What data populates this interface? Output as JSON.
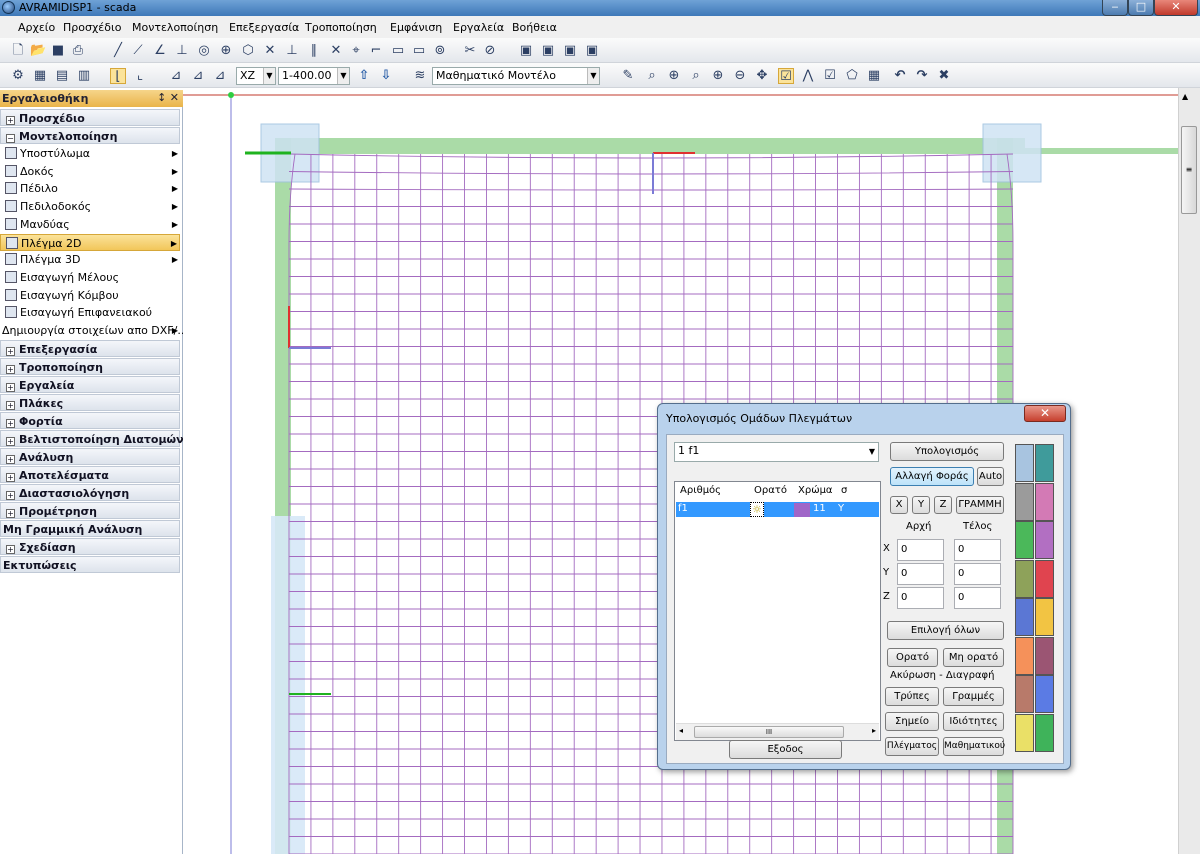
{
  "window": {
    "title": "AVRAMIDISP1 - scada",
    "minimize": "‒",
    "maximize": "□",
    "close": "✕"
  },
  "menu": [
    "Αρχείο",
    "Προσχέδιο",
    "Μοντελοποίηση",
    "Επεξεργασία",
    "Τροποποίηση",
    "Εμφάνιση",
    "Εργαλεία",
    "Βοήθεια"
  ],
  "toolbar2": {
    "plane_select": "XZ",
    "level_select": "1-400.00",
    "model_select": "Μαθηματικό Μοντέλο"
  },
  "toolbox": {
    "title": "Εργαλειοθήκη",
    "pin": "↕ ✕",
    "rows": [
      {
        "kind": "cat",
        "label": "Προσχέδιο",
        "expanded": false
      },
      {
        "kind": "cat",
        "label": "Μοντελοποίηση",
        "expanded": true
      },
      {
        "kind": "sub",
        "label": "Υποστύλωμα",
        "arrow": true
      },
      {
        "kind": "sub",
        "label": "Δοκός",
        "arrow": true
      },
      {
        "kind": "sub",
        "label": "Πέδιλο",
        "arrow": true
      },
      {
        "kind": "sub",
        "label": "Πεδιλοδοκός",
        "arrow": true
      },
      {
        "kind": "sub",
        "label": "Μανδύας",
        "arrow": true
      },
      {
        "kind": "sub",
        "label": "Πλέγμα 2D",
        "arrow": true,
        "selected": true
      },
      {
        "kind": "sub",
        "label": "Πλέγμα 3D",
        "arrow": true
      },
      {
        "kind": "sub",
        "label": "Εισαγωγή Μέλους"
      },
      {
        "kind": "sub",
        "label": "Εισαγωγή Κόμβου"
      },
      {
        "kind": "sub",
        "label": "Εισαγωγή Επιφανειακού"
      },
      {
        "kind": "sub",
        "label": "Δημιουργία στοιχείων απο DXF/...",
        "arrow": true,
        "noicon": true
      },
      {
        "kind": "cat",
        "label": "Επεξεργασία",
        "expanded": false
      },
      {
        "kind": "cat",
        "label": "Τροποποίηση",
        "expanded": false
      },
      {
        "kind": "cat",
        "label": "Εργαλεία",
        "expanded": false
      },
      {
        "kind": "cat",
        "label": "Πλάκες",
        "expanded": false
      },
      {
        "kind": "cat",
        "label": "Φορτία",
        "expanded": false
      },
      {
        "kind": "cat",
        "label": "Βελτιστοποίηση Διατομών",
        "expanded": false
      },
      {
        "kind": "cat",
        "label": "Ανάλυση",
        "expanded": false
      },
      {
        "kind": "cat",
        "label": "Αποτελέσματα",
        "expanded": false
      },
      {
        "kind": "cat",
        "label": "Διαστασιολόγηση",
        "expanded": false
      },
      {
        "kind": "cat",
        "label": "Προμέτρηση",
        "expanded": false
      },
      {
        "kind": "cat",
        "label": "Μη Γραμμική Ανάλυση",
        "expanded": null
      },
      {
        "kind": "cat",
        "label": "Σχεδίαση",
        "expanded": false
      },
      {
        "kind": "cat",
        "label": "Εκτυπώσεις",
        "expanded": null
      }
    ]
  },
  "dialog": {
    "title": "Υπολογισμός Ομάδων Πλεγμάτων",
    "close": "✕",
    "group_select": "1 f1",
    "columns": [
      "Αριθμός",
      "Ορατό",
      "Χρώμα",
      "σ"
    ],
    "rows": [
      {
        "number": "f1",
        "visible": "☼",
        "color_code": "11",
        "sigma": "Y"
      }
    ],
    "hscroll_thumb": "III",
    "buttons": {
      "compute": "Υπολογισμός",
      "change_dir": "Αλλαγή Φοράς",
      "auto": "Auto",
      "x": "X",
      "y": "Y",
      "z": "Z",
      "line": "ΓΡΑΜΜΗ",
      "select_all": "Επιλογή όλων",
      "visible": "Ορατό",
      "not_visible": "Μη ορατό",
      "holes": "Τρύπες",
      "lines": "Γραμμές",
      "point": "Σημείο",
      "properties": "Ιδιότητες",
      "meshes": "Πλέγματος",
      "math": "Μαθηματικού",
      "exit": "Εξοδος"
    },
    "labels": {
      "start": "Αρχή",
      "end": "Τέλος",
      "x": "X",
      "y": "Y",
      "z": "Z",
      "cancel_delete": "Ακύρωση - Διαγραφή"
    },
    "coords": {
      "x_start": "0",
      "x_end": "0",
      "y_start": "0",
      "y_end": "0",
      "z_start": "0",
      "z_end": "0"
    },
    "palette": [
      "#a8c4e0",
      "#3f9b9b",
      "#9b9b9b",
      "#d37ab5",
      "#4bb85a",
      "#b26fc2",
      "#8ea25a",
      "#e0444f",
      "#5b77d4",
      "#f2c443",
      "#f5915a",
      "#9b5573",
      "#b87a6a",
      "#5b7be4",
      "#eae067",
      "#3fb35a"
    ],
    "list_color": "#3399ff",
    "row_swatch": "#a066c8"
  },
  "colors": {
    "mesh": "#a46bc0",
    "green_band": "#8dcf8a",
    "accent": "#3399ff"
  }
}
